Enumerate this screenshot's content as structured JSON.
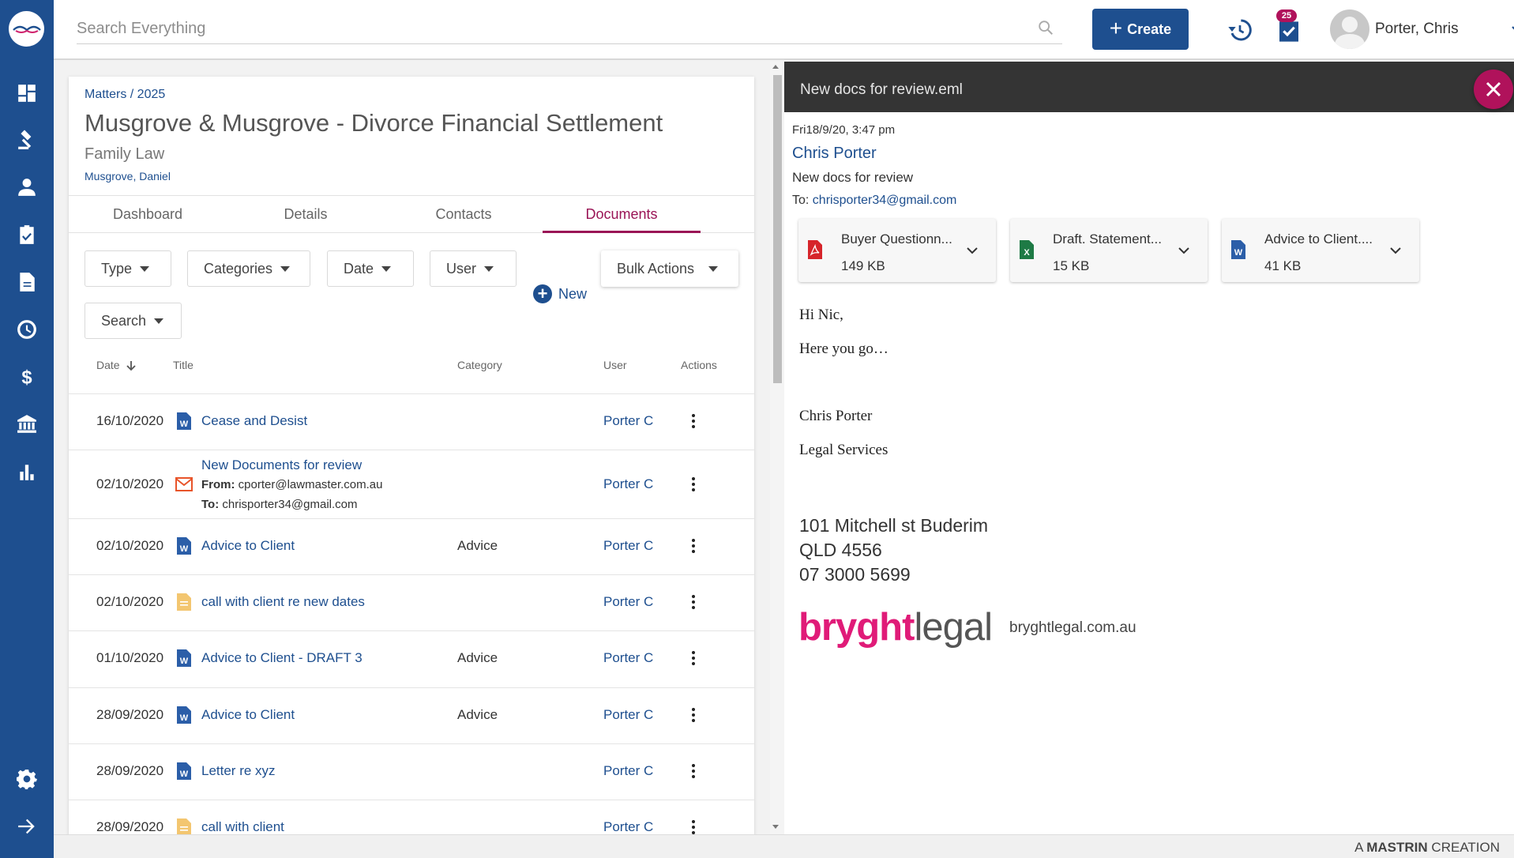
{
  "search": {
    "placeholder": "Search Everything"
  },
  "header": {
    "create_label": "Create",
    "task_badge": "25",
    "user_name": "Porter, Chris"
  },
  "matter": {
    "breadcrumb": "Matters / 2025",
    "title": "Musgrove & Musgrove - Divorce Financial Settlement",
    "type": "Family Law",
    "client": "Musgrove, Daniel"
  },
  "tabs": [
    "Dashboard",
    "Details",
    "Contacts",
    "Documents"
  ],
  "active_tab": "Documents",
  "filters": {
    "type": "Type",
    "categories": "Categories",
    "date": "Date",
    "user": "User",
    "search": "Search",
    "bulk_actions": "Bulk Actions",
    "new": "New"
  },
  "columns": {
    "date": "Date",
    "title": "Title",
    "category": "Category",
    "user": "User",
    "actions": "Actions"
  },
  "documents": [
    {
      "date": "16/10/2020",
      "icon": "word-doc-icon",
      "title": "Cease and Desist",
      "category": "",
      "user": "Porter C"
    },
    {
      "date": "02/10/2020",
      "icon": "email-icon",
      "title": "New Documents for review",
      "from_label": "From:",
      "from": "cporter@lawmaster.com.au",
      "to_label": "To:",
      "to": "chrisporter34@gmail.com",
      "category": "",
      "user": "Porter C"
    },
    {
      "date": "02/10/2020",
      "icon": "word-doc-icon",
      "title": "Advice to Client",
      "category": "Advice",
      "user": "Porter C"
    },
    {
      "date": "02/10/2020",
      "icon": "note-icon",
      "title": "call with client re new dates",
      "category": "",
      "user": "Porter C"
    },
    {
      "date": "01/10/2020",
      "icon": "word-doc-icon",
      "title": "Advice to Client - DRAFT 3",
      "category": "Advice",
      "user": "Porter C"
    },
    {
      "date": "28/09/2020",
      "icon": "word-doc-icon",
      "title": "Advice to Client",
      "category": "Advice",
      "user": "Porter C"
    },
    {
      "date": "28/09/2020",
      "icon": "word-doc-icon",
      "title": "Letter re xyz",
      "category": "",
      "user": "Porter C"
    },
    {
      "date": "28/09/2020",
      "icon": "note-icon",
      "title": "call with client",
      "category": "",
      "user": "Porter C"
    }
  ],
  "preview": {
    "file_name": "New docs for review.eml",
    "date": "Fri18/9/20, 3:47 pm",
    "from": "Chris Porter",
    "subject": "New docs for review",
    "to_label": "To:",
    "to": "chrisporter34@gmail.com",
    "attachments": [
      {
        "name": "Buyer Questionn...",
        "size": "149 KB",
        "icon": "pdf-icon"
      },
      {
        "name": "Draft. Statement...",
        "size": "15 KB",
        "icon": "excel-icon"
      },
      {
        "name": "Advice to Client....",
        "size": "41 KB",
        "icon": "word-doc-icon"
      }
    ],
    "body": {
      "greeting": "Hi Nic,",
      "line1": "Here you go…",
      "sig_name": "Chris Porter",
      "sig_dept": "Legal Services",
      "address1": "101 Mitchell st Buderim",
      "address2": "QLD 4556",
      "phone": "07 3000 5699",
      "logo_part1": "bryght",
      "logo_part2": "legal",
      "website": "bryghtlegal.com.au"
    }
  },
  "footer": {
    "prefix": "A",
    "brand": "MASTRIN",
    "suffix": "CREATION"
  },
  "colors": {
    "primary": "#1e4f8f",
    "accent": "#9a1456",
    "close": "#b0125b"
  }
}
